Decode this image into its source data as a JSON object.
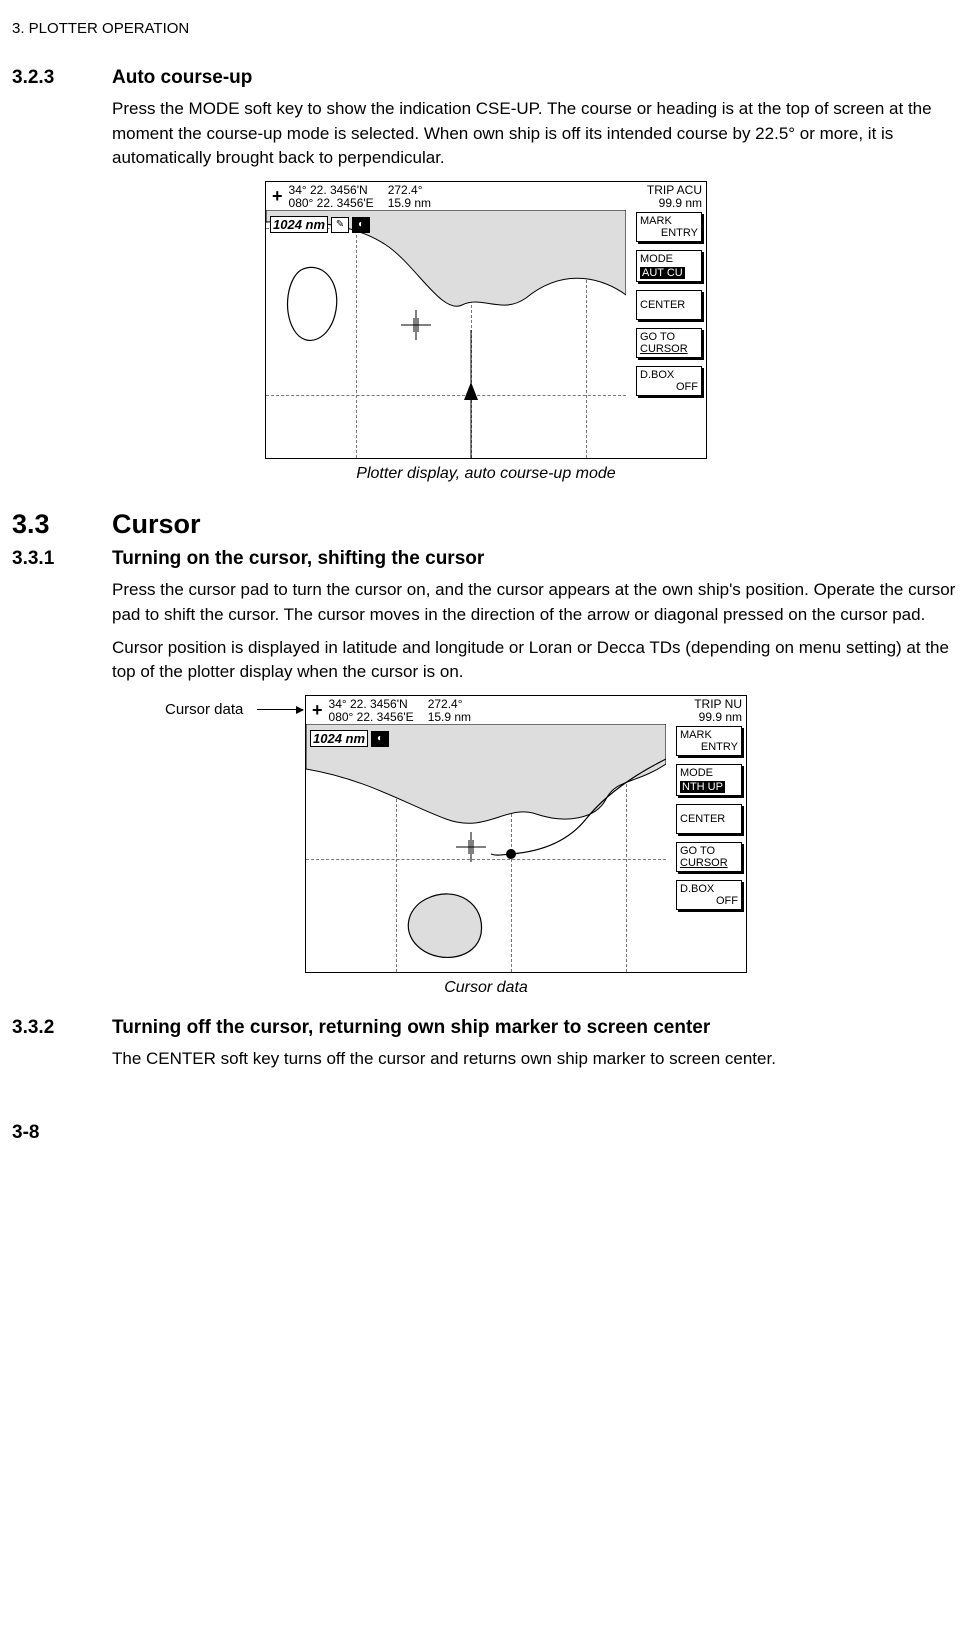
{
  "chapter": "3. PLOTTER OPERATION",
  "s323": {
    "num": "3.2.3",
    "title": "Auto course-up",
    "body": "Press the MODE soft key to show the indication CSE-UP. The course or heading is at the top of screen at the moment the course-up mode is selected. When own ship is off its intended course by 22.5° or more, it is automatically brought back to perpendicular."
  },
  "fig1": {
    "caption": "Plotter display, auto course-up mode",
    "lat": " 34° 22. 3456'N",
    "lon": "080° 22. 3456'E",
    "bearing": "272.4°",
    "dist": "15.9 nm",
    "trip_label": "TRIP  ACU",
    "trip_val": "99.9 nm",
    "range": "1024 nm",
    "sk1a": "MARK",
    "sk1b": "ENTRY",
    "sk2a": "MODE",
    "sk2b": "AUT CU",
    "sk3": "CENTER",
    "sk4a": "GO TO",
    "sk4b": "CURSOR",
    "sk5a": "D.BOX",
    "sk5b": "OFF"
  },
  "s33": {
    "num": "3.3",
    "title": "Cursor"
  },
  "s331": {
    "num": "3.3.1",
    "title": "Turning on the cursor, shifting the cursor",
    "p1": "Press the cursor pad to turn the cursor on, and the cursor appears at the own ship's position. Operate the cursor pad to shift the cursor. The cursor moves in the direction of the arrow or diagonal pressed on the cursor pad.",
    "p2": "Cursor position is displayed in latitude and longitude or Loran or Decca TDs (depending on menu setting) at the top of the plotter display when the cursor is on."
  },
  "fig2": {
    "caption": "Cursor data",
    "callout": "Cursor data",
    "lat": " 34° 22. 3456'N",
    "lon": "080° 22. 3456'E",
    "bearing": "272.4°",
    "dist": "15.9 nm",
    "trip_label": "TRIP  NU",
    "trip_val": "99.9 nm",
    "range": "1024 nm",
    "sk1a": "MARK",
    "sk1b": "ENTRY",
    "sk2a": "MODE",
    "sk2b": "NTH UP",
    "sk3": "CENTER",
    "sk4a": "GO TO",
    "sk4b": "CURSOR",
    "sk5a": "D.BOX",
    "sk5b": "OFF"
  },
  "s332": {
    "num": "3.3.2",
    "title": "Turning off the cursor, returning own ship marker to screen center",
    "body": "The CENTER soft key turns off the cursor and returns own ship marker to screen center."
  },
  "page": "3-8"
}
